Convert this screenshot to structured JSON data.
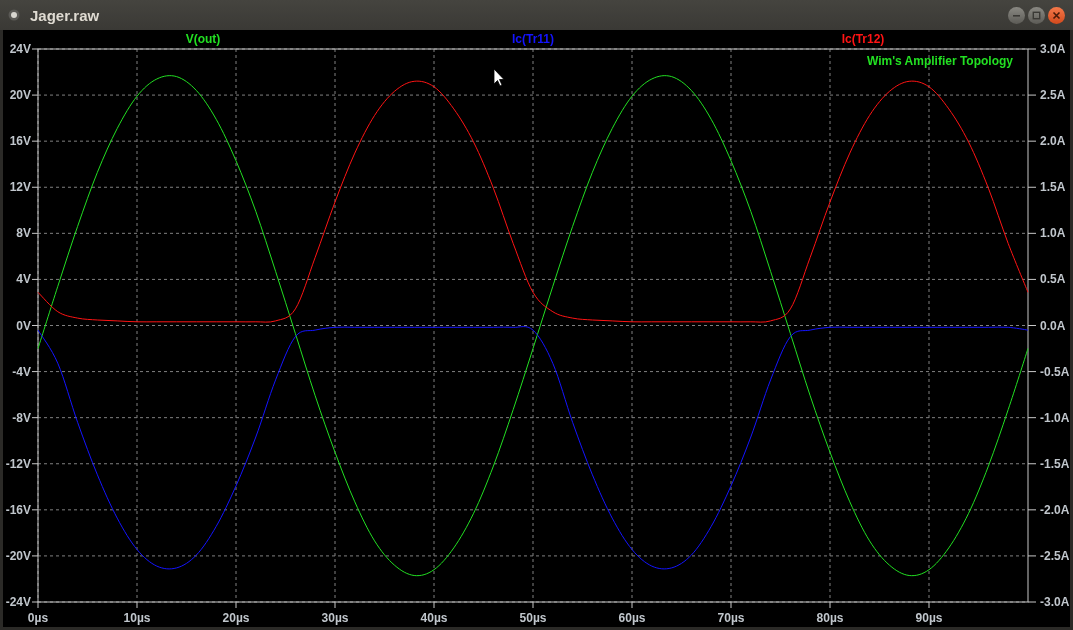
{
  "window": {
    "title": "Jager.raw"
  },
  "plot": {
    "annotation": "Wim's Amplifier Topology",
    "chart_data": {
      "type": "line",
      "grid": true,
      "xlim": [
        0,
        100
      ],
      "ylim": [
        -24,
        24
      ],
      "y2lim": [
        -3,
        3
      ],
      "xticks": [
        {
          "value": 0,
          "label": "0µs"
        },
        {
          "value": 10,
          "label": "10µs"
        },
        {
          "value": 20,
          "label": "20µs"
        },
        {
          "value": 30,
          "label": "30µs"
        },
        {
          "value": 40,
          "label": "40µs"
        },
        {
          "value": 50,
          "label": "50µs"
        },
        {
          "value": 60,
          "label": "60µs"
        },
        {
          "value": 70,
          "label": "70µs"
        },
        {
          "value": 80,
          "label": "80µs"
        },
        {
          "value": 90,
          "label": "90µs"
        }
      ],
      "yticks": [
        {
          "value": 24,
          "label": "24V"
        },
        {
          "value": 20,
          "label": "20V"
        },
        {
          "value": 16,
          "label": "16V"
        },
        {
          "value": 12,
          "label": "12V"
        },
        {
          "value": 8,
          "label": "8V"
        },
        {
          "value": 4,
          "label": "4V"
        },
        {
          "value": 0,
          "label": "0V"
        },
        {
          "value": -4,
          "label": "-4V"
        },
        {
          "value": -8,
          "label": "-8V"
        },
        {
          "value": -12,
          "label": "-12V"
        },
        {
          "value": -16,
          "label": "-16V"
        },
        {
          "value": -20,
          "label": "-20V"
        },
        {
          "value": -24,
          "label": "-24V"
        }
      ],
      "y2ticks": [
        {
          "value": 3,
          "label": "3.0A"
        },
        {
          "value": 2.5,
          "label": "2.5A"
        },
        {
          "value": 2,
          "label": "2.0A"
        },
        {
          "value": 1.5,
          "label": "1.5A"
        },
        {
          "value": 1,
          "label": "1.0A"
        },
        {
          "value": 0.5,
          "label": "0.5A"
        },
        {
          "value": 0,
          "label": "0.0A"
        },
        {
          "value": -0.5,
          "label": "-0.5A"
        },
        {
          "value": -1,
          "label": "-1.0A"
        },
        {
          "value": -1.5,
          "label": "-1.5A"
        },
        {
          "value": -2,
          "label": "-2.0A"
        },
        {
          "value": -2.5,
          "label": "-2.5A"
        },
        {
          "value": -3,
          "label": "-3.0A"
        }
      ],
      "x": [
        0,
        2,
        4,
        6,
        8,
        10,
        12,
        14,
        16,
        18,
        20,
        22,
        24,
        26,
        28,
        30,
        32,
        34,
        36,
        38,
        40,
        42,
        44,
        46,
        48,
        50,
        52,
        54,
        56,
        58,
        60,
        62,
        64,
        66,
        68,
        70,
        72,
        74,
        76,
        78,
        80,
        82,
        84,
        86,
        88,
        90,
        92,
        94,
        96,
        98,
        100
      ],
      "series": [
        {
          "name": "V(out)",
          "color": "#22e022",
          "axis": "y",
          "values": [
            -2.0,
            3.4,
            8.6,
            13.3,
            17.1,
            19.9,
            21.4,
            21.6,
            20.4,
            17.9,
            14.3,
            9.9,
            4.7,
            -0.7,
            -6.1,
            -11.0,
            -15.3,
            -18.7,
            -20.8,
            -21.7,
            -21.2,
            -19.3,
            -16.3,
            -12.2,
            -7.3,
            -2.0,
            3.4,
            8.6,
            13.3,
            17.1,
            19.9,
            21.4,
            21.6,
            20.4,
            17.9,
            14.3,
            9.9,
            4.7,
            -0.7,
            -6.1,
            -11.0,
            -15.3,
            -18.7,
            -20.8,
            -21.7,
            -21.2,
            -19.3,
            -16.3,
            -12.2,
            -7.3,
            -2.0
          ]
        },
        {
          "name": "Ic(Tr11)",
          "color": "#1414ff",
          "axis": "y2",
          "values": [
            -0.05,
            -0.41,
            -1.05,
            -1.62,
            -2.09,
            -2.43,
            -2.61,
            -2.63,
            -2.49,
            -2.18,
            -1.74,
            -1.21,
            -0.59,
            -0.12,
            -0.05,
            -0.02,
            -0.02,
            -0.02,
            -0.02,
            -0.02,
            -0.02,
            -0.02,
            -0.02,
            -0.02,
            -0.02,
            -0.05,
            -0.41,
            -1.05,
            -1.62,
            -2.09,
            -2.43,
            -2.61,
            -2.63,
            -2.49,
            -2.18,
            -1.74,
            -1.21,
            -0.59,
            -0.12,
            -0.05,
            -0.02,
            -0.02,
            -0.02,
            -0.02,
            -0.02,
            -0.02,
            -0.02,
            -0.02,
            -0.02,
            -0.02,
            -0.05
          ]
        },
        {
          "name": "Ic(Tr12)",
          "color": "#ff1414",
          "axis": "y2",
          "values": [
            0.36,
            0.15,
            0.08,
            0.06,
            0.05,
            0.04,
            0.04,
            0.04,
            0.04,
            0.04,
            0.04,
            0.04,
            0.05,
            0.18,
            0.74,
            1.34,
            1.87,
            2.28,
            2.54,
            2.65,
            2.59,
            2.35,
            1.99,
            1.49,
            0.89,
            0.36,
            0.15,
            0.08,
            0.06,
            0.05,
            0.04,
            0.04,
            0.04,
            0.04,
            0.04,
            0.04,
            0.04,
            0.05,
            0.18,
            0.74,
            1.34,
            1.87,
            2.28,
            2.54,
            2.65,
            2.59,
            2.35,
            1.99,
            1.49,
            0.89,
            0.36
          ]
        }
      ]
    }
  }
}
